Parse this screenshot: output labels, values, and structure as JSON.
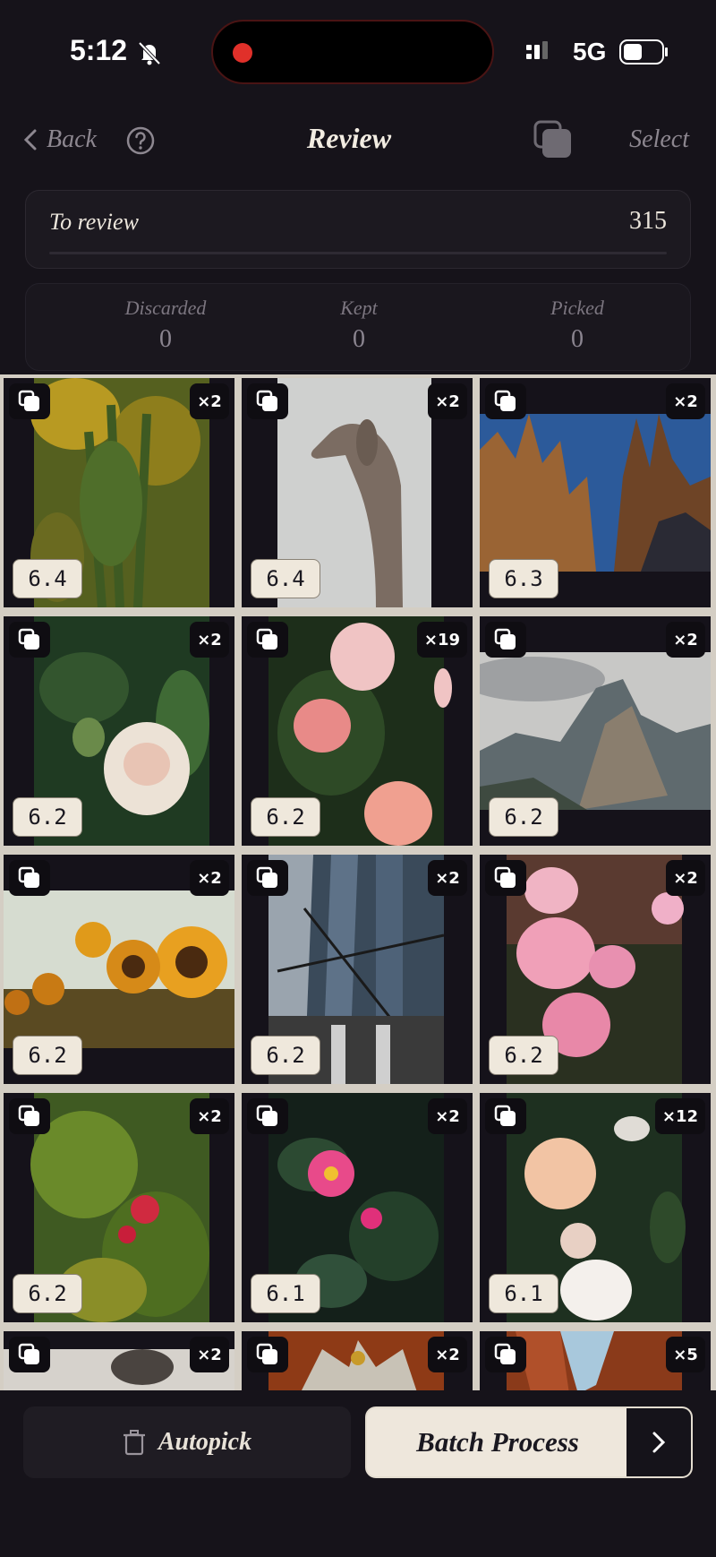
{
  "status_bar": {
    "time": "5:12",
    "network": "5G"
  },
  "nav": {
    "back_label": "Back",
    "title": "Review",
    "select_label": "Select"
  },
  "review": {
    "label": "To review",
    "count": "315",
    "progress": 0
  },
  "stats": [
    {
      "label": "Discarded",
      "value": "0"
    },
    {
      "label": "Kept",
      "value": "0"
    },
    {
      "label": "Picked",
      "value": "0"
    }
  ],
  "photos": [
    {
      "subject": "goldenrod-plants",
      "count": "×2",
      "score": "6.4"
    },
    {
      "subject": "weimaraner-dog",
      "count": "×2",
      "score": "6.4"
    },
    {
      "subject": "cathedral-spires",
      "count": "×2",
      "score": "6.3"
    },
    {
      "subject": "white-rose",
      "count": "×2",
      "score": "6.2"
    },
    {
      "subject": "pink-roses",
      "count": "×19",
      "score": "6.2"
    },
    {
      "subject": "mountain-valley",
      "count": "×2",
      "score": "6.2"
    },
    {
      "subject": "sunflowers",
      "count": "×2",
      "score": "6.2"
    },
    {
      "subject": "glass-tower",
      "count": "×2",
      "score": "6.2"
    },
    {
      "subject": "pink-rose-bush",
      "count": "×2",
      "score": "6.2"
    },
    {
      "subject": "pomegranate-tree",
      "count": "×2",
      "score": "6.2"
    },
    {
      "subject": "camellia-flowers",
      "count": "×2",
      "score": "6.1"
    },
    {
      "subject": "peach-roses",
      "count": "×12",
      "score": "6.1"
    },
    {
      "subject": "sculpture",
      "count": "×2",
      "score": ""
    },
    {
      "subject": "ornament-figure",
      "count": "×2",
      "score": ""
    },
    {
      "subject": "canyon-rock",
      "count": "×5",
      "score": ""
    }
  ],
  "bottom": {
    "autopick_label": "Autopick",
    "batch_label": "Batch Process"
  }
}
